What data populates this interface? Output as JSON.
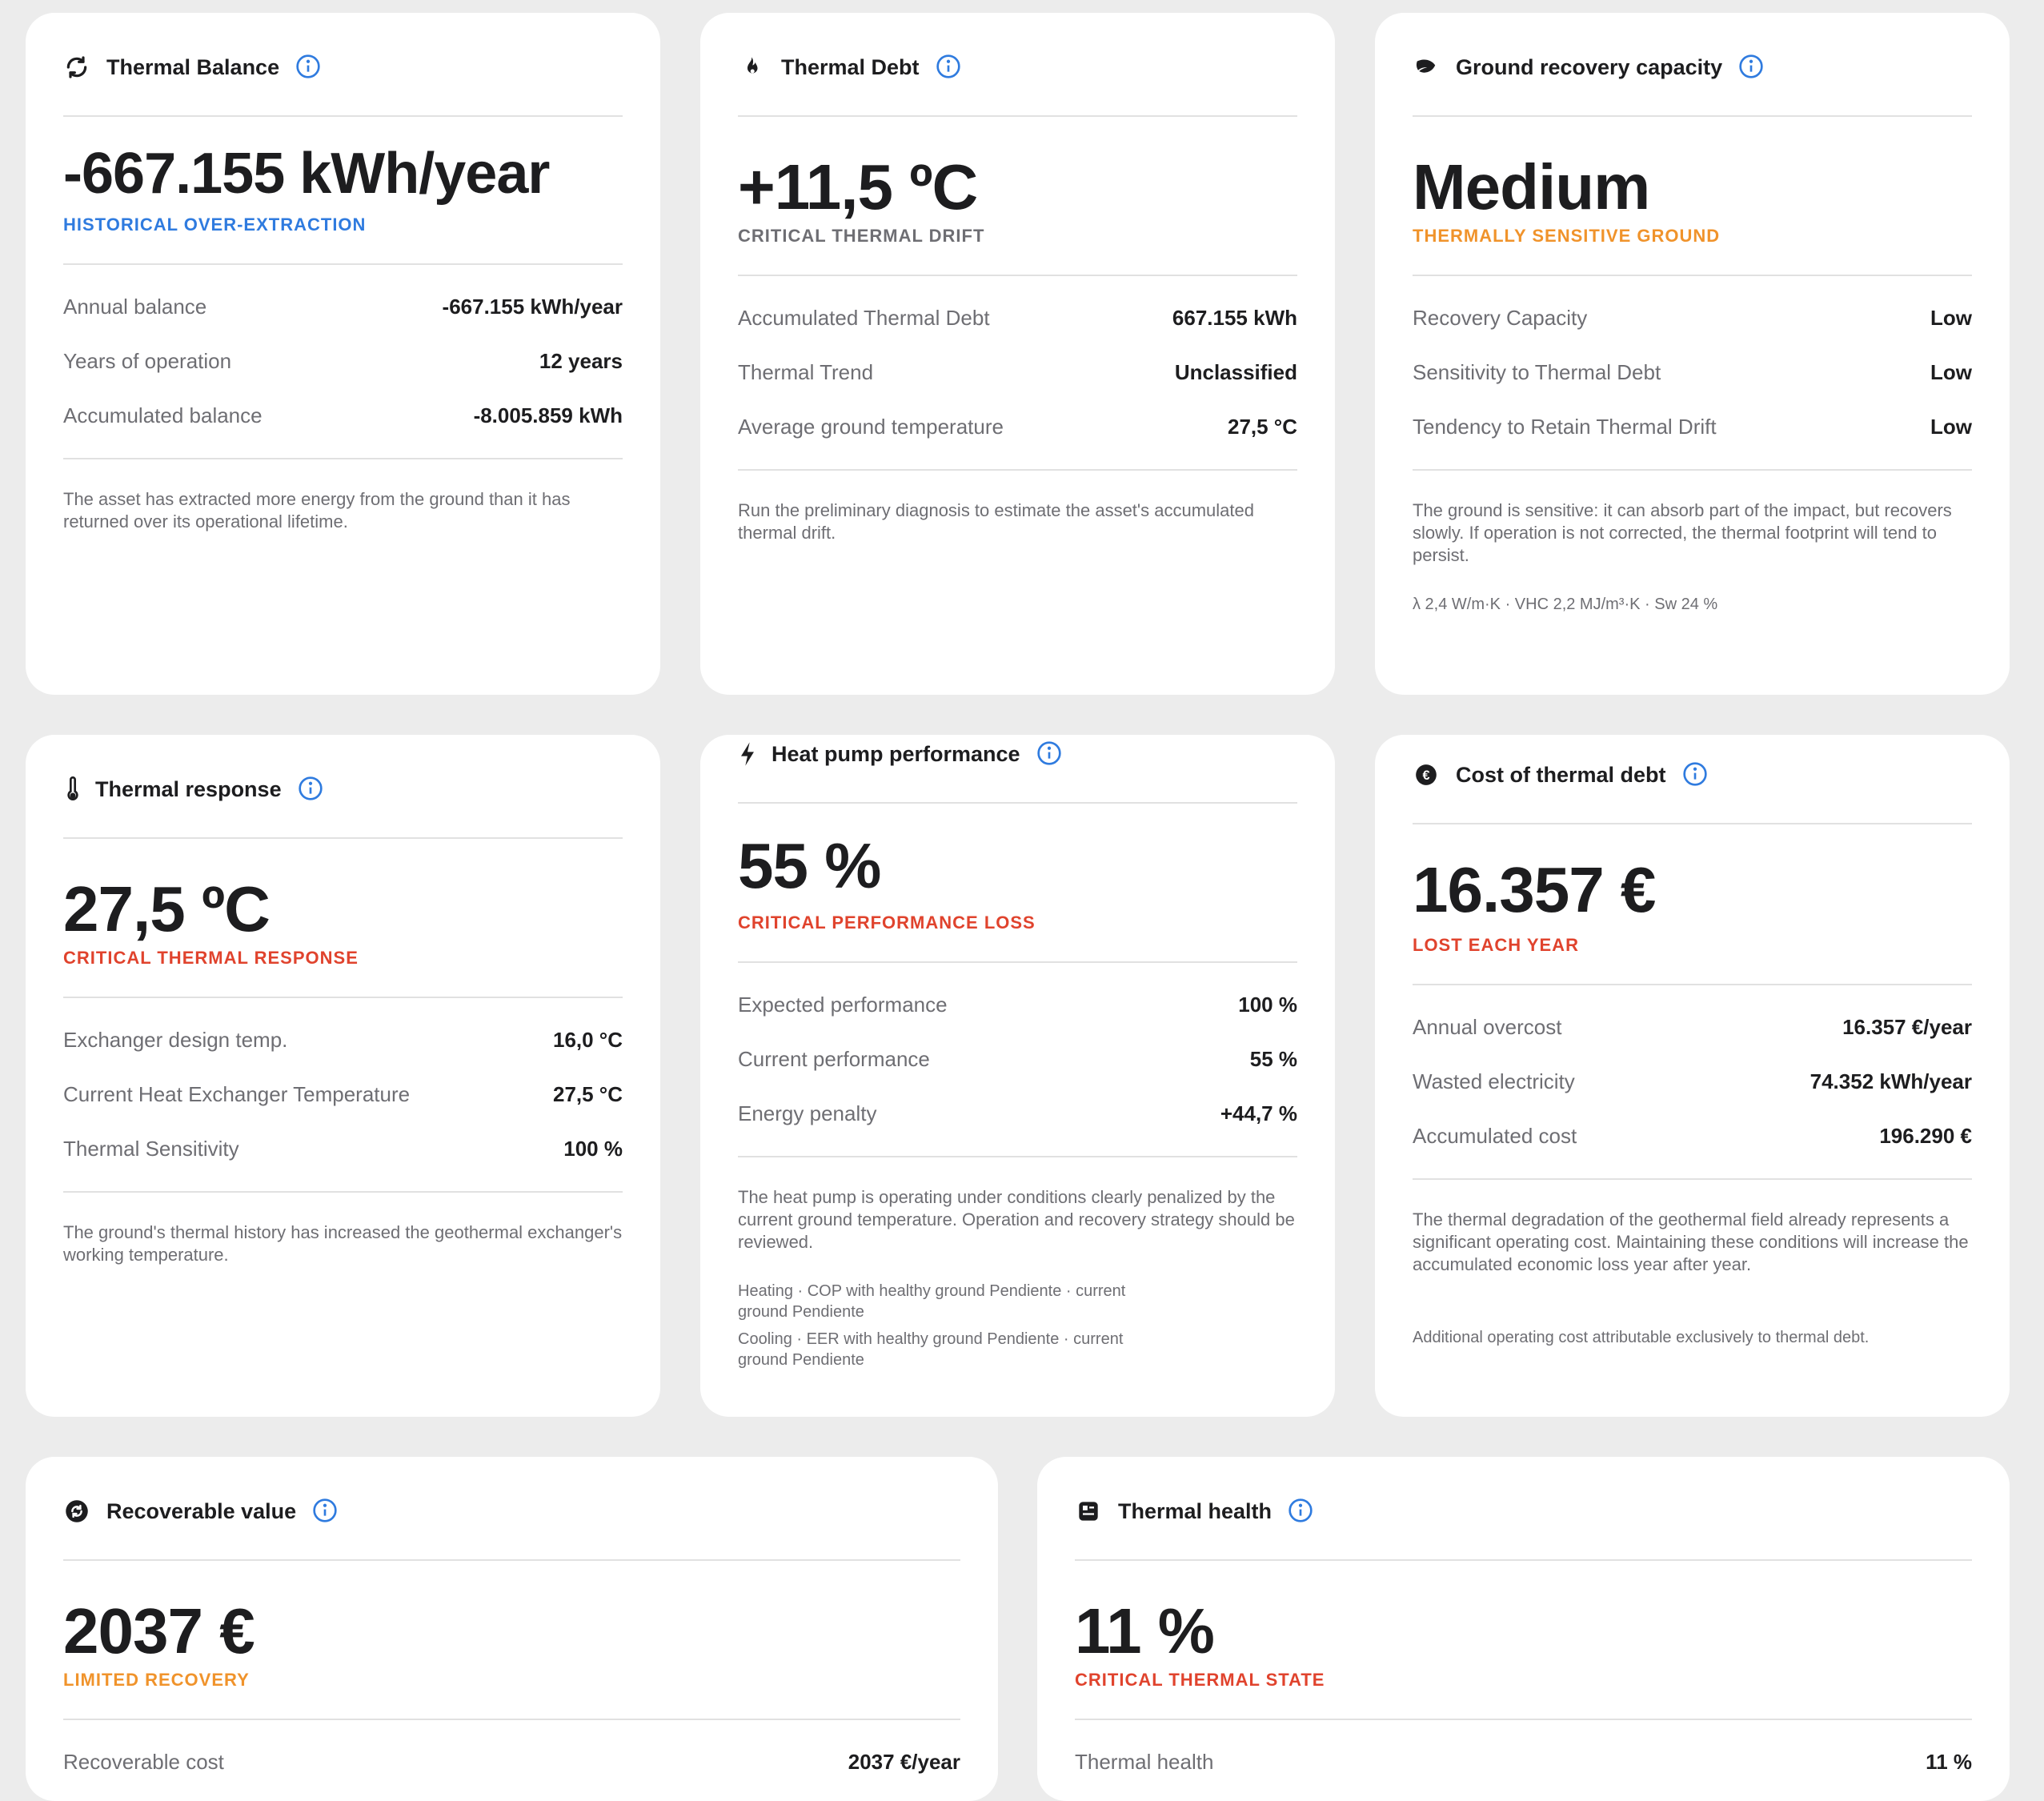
{
  "colors": {
    "blue": "#2f7bdf",
    "orange": "#f0932b",
    "red": "#e0432d",
    "grey": "#6e6e73"
  },
  "cards": {
    "balance": {
      "title": "Thermal Balance",
      "icon": "refresh-icon",
      "value": "-667.155 kWh/year",
      "tag": "HISTORICAL OVER-EXTRACTION",
      "rows": [
        {
          "k": "Annual balance",
          "v": "-667.155 kWh/year"
        },
        {
          "k": "Years of operation",
          "v": "12 years"
        },
        {
          "k": "Accumulated balance",
          "v": "-8.005.859 kWh"
        }
      ],
      "desc": "The asset has extracted more energy from the ground than it has returned over its operational lifetime."
    },
    "debt": {
      "title": "Thermal Debt",
      "icon": "flame-icon",
      "value": "+11,5 ºC",
      "tag": "CRITICAL THERMAL DRIFT",
      "rows": [
        {
          "k": "Accumulated Thermal Debt",
          "v": "667.155 kWh"
        },
        {
          "k": "Thermal Trend",
          "v": "Unclassified"
        },
        {
          "k": "Average ground temperature",
          "v": "27,5 °C"
        }
      ],
      "desc": "Run the preliminary diagnosis to estimate the asset's accumulated thermal drift."
    },
    "recovery": {
      "title": "Ground recovery capacity",
      "icon": "leaf-icon",
      "value": "Medium",
      "tag": "THERMALLY SENSITIVE GROUND",
      "rows": [
        {
          "k": "Recovery Capacity",
          "v": "Low"
        },
        {
          "k": "Sensitivity to Thermal Debt",
          "v": "Low"
        },
        {
          "k": "Tendency to Retain Thermal Drift",
          "v": "Low"
        }
      ],
      "desc": "The ground is sensitive: it can absorb part of the impact, but recovers slowly. If operation is not corrected, the thermal footprint will tend to persist.",
      "note": "λ 2,4 W/m·K · VHC 2,2 MJ/m³·K · Sw 24 %"
    },
    "response": {
      "title": "Thermal response",
      "icon": "thermometer-icon",
      "value": "27,5 ºC",
      "tag": "CRITICAL THERMAL RESPONSE",
      "rows": [
        {
          "k": "Exchanger design temp.",
          "v": "16,0 °C"
        },
        {
          "k": "Current Heat Exchanger Temperature",
          "v": "27,5 °C"
        },
        {
          "k": "Thermal Sensitivity",
          "v": "100 %"
        }
      ],
      "desc": "The ground's thermal history has increased the geothermal exchanger's working temperature."
    },
    "pump": {
      "title": "Heat pump performance",
      "icon": "bolt-icon",
      "value": "55 %",
      "tag": "CRITICAL PERFORMANCE LOSS",
      "rows": [
        {
          "k": "Expected performance",
          "v": "100 %"
        },
        {
          "k": "Current performance",
          "v": "55 %"
        },
        {
          "k": "Energy penalty",
          "v": "+44,7 %"
        }
      ],
      "desc": "The heat pump is operating under conditions clearly penalized by the current ground temperature. Operation and recovery strategy should be reviewed.",
      "note1a": "Heating · COP with healthy ground Pendiente · current",
      "note1b": "ground Pendiente",
      "note2a": "Cooling · EER with healthy ground Pendiente · current",
      "note2b": "ground Pendiente"
    },
    "cost": {
      "title": "Cost of thermal debt",
      "icon": "euro-coin-icon",
      "value": "16.357 €",
      "tag": "LOST EACH YEAR",
      "rows": [
        {
          "k": "Annual overcost",
          "v": "16.357 €/year"
        },
        {
          "k": "Wasted electricity",
          "v": "74.352 kWh/year"
        },
        {
          "k": "Accumulated cost",
          "v": "196.290 €"
        }
      ],
      "desc": "The thermal degradation of the geothermal field already represents a significant operating cost. Maintaining these conditions will increase the accumulated economic loss year after year.",
      "note": "Additional operating cost attributable exclusively to thermal debt."
    },
    "recoverable": {
      "title": "Recoverable value",
      "icon": "recycle-icon",
      "value": "2037 €",
      "tag": "LIMITED RECOVERY",
      "rows": [
        {
          "k": "Recoverable cost",
          "v": "2037 €/year"
        }
      ]
    },
    "health": {
      "title": "Thermal health",
      "icon": "health-report-icon",
      "value": "11 %",
      "tag": "CRITICAL THERMAL STATE",
      "rows": [
        {
          "k": "Thermal health",
          "v": "11 %"
        }
      ]
    }
  }
}
